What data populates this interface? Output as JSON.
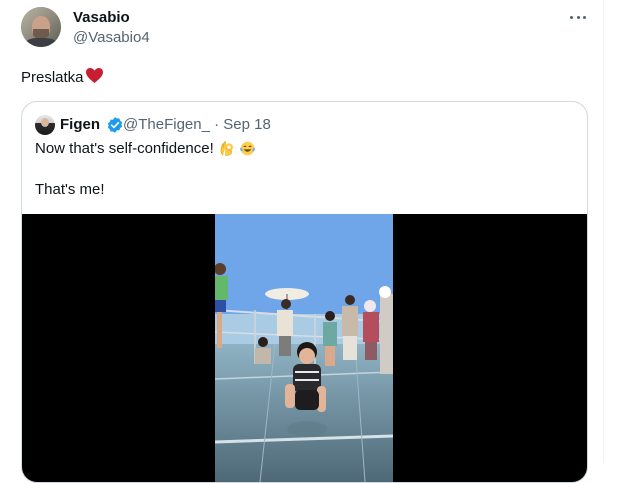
{
  "tweet": {
    "author_name": "Vasabio",
    "author_handle": "@Vasabio4",
    "text": "Preslatka",
    "heart_emoji": "heart-icon"
  },
  "quoted_tweet": {
    "author_name": "Figen",
    "author_handle": "@TheFigen_",
    "separator": "·",
    "date": "Sep 18",
    "text_line1": "Now that's self-confidence!",
    "text_line2": "That's me!",
    "emojis": [
      "ok-hand-icon",
      "tears-of-joy-icon"
    ],
    "media_type": "video"
  },
  "colors": {
    "text_primary": "#0f1419",
    "text_secondary": "#536471",
    "verified_blue": "#1d9bf0",
    "heart_red": "#c81e34",
    "border": "#cfd9de"
  }
}
